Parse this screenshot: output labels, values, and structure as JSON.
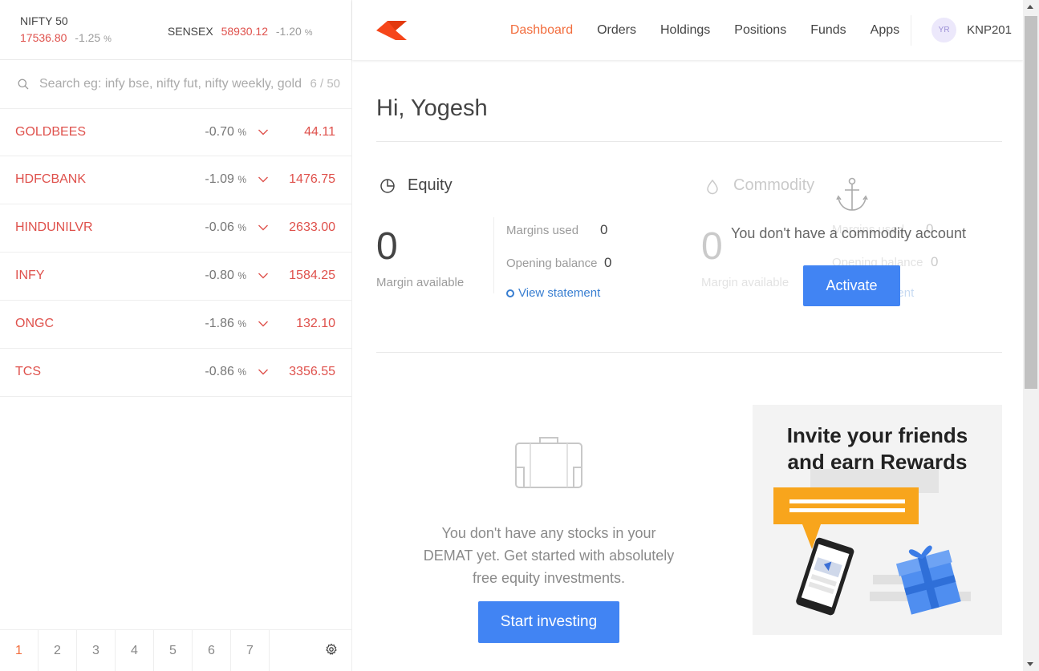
{
  "indices": {
    "nifty": {
      "name": "NIFTY 50",
      "value": "17536.80",
      "change": "-1.25",
      "unit": "%"
    },
    "sensex": {
      "name": "SENSEX",
      "value": "58930.12",
      "change": "-1.20",
      "unit": "%"
    }
  },
  "search": {
    "placeholder": "Search eg: infy bse, nifty fut, nifty weekly, gold mcx",
    "count": "6 / 50"
  },
  "watchlist": [
    {
      "symbol": "GOLDBEES",
      "change": "-0.70",
      "unit": "%",
      "price": "44.11"
    },
    {
      "symbol": "HDFCBANK",
      "change": "-1.09",
      "unit": "%",
      "price": "1476.75"
    },
    {
      "symbol": "HINDUNILVR",
      "change": "-0.06",
      "unit": "%",
      "price": "2633.00"
    },
    {
      "symbol": "INFY",
      "change": "-0.80",
      "unit": "%",
      "price": "1584.25"
    },
    {
      "symbol": "ONGC",
      "change": "-1.86",
      "unit": "%",
      "price": "132.10"
    },
    {
      "symbol": "TCS",
      "change": "-0.86",
      "unit": "%",
      "price": "3356.55"
    }
  ],
  "pager": {
    "tabs": [
      "1",
      "2",
      "3",
      "4",
      "5",
      "6",
      "7"
    ],
    "active": "1"
  },
  "nav": {
    "items": [
      "Dashboard",
      "Orders",
      "Holdings",
      "Positions",
      "Funds",
      "Apps"
    ],
    "active": "Dashboard",
    "avatar_initials": "YR",
    "user_id": "KNP201"
  },
  "main": {
    "greeting": "Hi, Yogesh",
    "equity": {
      "title": "Equity",
      "margin_available": "0",
      "margin_available_label": "Margin available",
      "margins_used_label": "Margins used",
      "margins_used": "0",
      "opening_balance_label": "Opening balance",
      "opening_balance": "0",
      "statement_link": "View statement"
    },
    "commodity": {
      "title": "Commodity",
      "margin_available": "0",
      "margin_available_label": "Margin available",
      "margins_used_label": "Margins used",
      "margins_used": "0",
      "opening_balance_label": "Opening balance",
      "opening_balance": "0",
      "statement_link": "View statement",
      "no_account_text": "You don't have a commodity account",
      "activate_label": "Activate"
    },
    "holdings_empty": {
      "line1": "You don't have any stocks in your",
      "line2": "DEMAT yet. Get started with absolutely",
      "line3": "free equity investments.",
      "cta": "Start investing"
    },
    "promo": {
      "line1": "Invite your friends",
      "line2": "and earn Rewards"
    }
  },
  "colors": {
    "accent": "#f26d3d",
    "negative": "#df514c",
    "button": "#4184f3",
    "link": "#387ed1"
  }
}
